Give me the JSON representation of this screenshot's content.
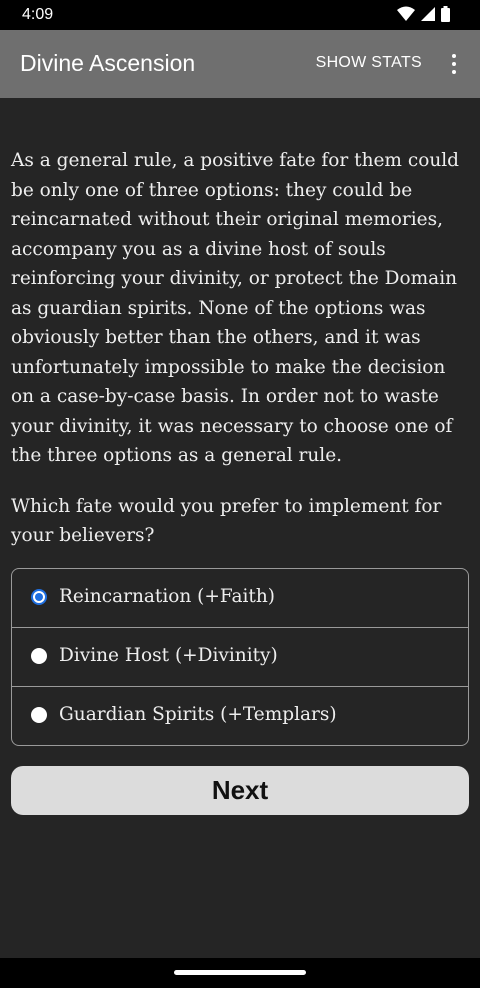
{
  "status_bar": {
    "time": "4:09",
    "icons": [
      "wifi-icon",
      "cell-signal-icon",
      "battery-icon"
    ]
  },
  "app_bar": {
    "title": "Divine Ascension",
    "show_stats": "SHOW STATS",
    "overflow_icon": "more-vert-icon"
  },
  "story": {
    "paragraph": "As a general rule, a positive fate for them could be only one of three options: they could be reincarnated without their original memories, accompany you as a divine host of souls reinforcing your divinity, or protect the Domain as guardian spirits. None of the options was obviously better than the others, and it was unfortunately impossible to make the decision on a case-by-case basis. In order not to waste your divinity, it was necessary to choose one of the three options as a general rule.",
    "question": "Which fate would you prefer to implement for your believers?"
  },
  "choices": [
    {
      "label": "Reincarnation (+Faith)",
      "selected": true
    },
    {
      "label": "Divine Host (+Divinity)",
      "selected": false
    },
    {
      "label": "Guardian Spirits (+Templars)",
      "selected": false
    }
  ],
  "next_button": "Next",
  "colors": {
    "accent": "#1f6fe0",
    "app_bar": "#6f6f6f",
    "background": "#252525"
  }
}
